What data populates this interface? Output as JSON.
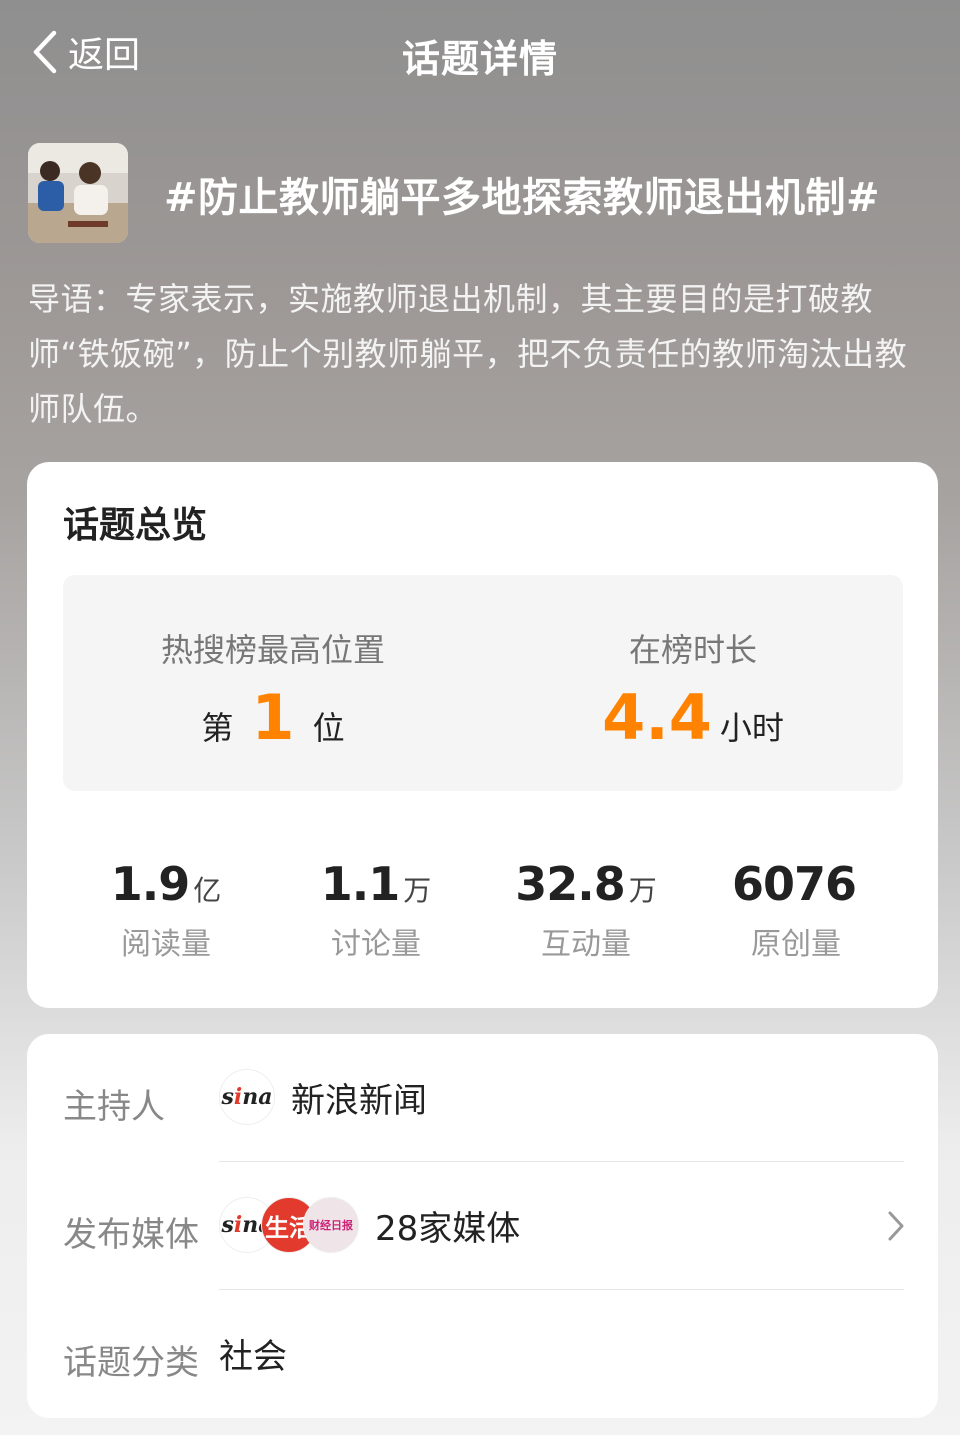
{
  "header": {
    "back_label": "返回",
    "title": "话题详情"
  },
  "topic": {
    "title": "#防止教师躺平多地探索教师退出机制#",
    "intro": "导语：专家表示，实施教师退出机制，其主要目的是打破教师“铁饭碗”，防止个别教师躺平，把不负责任的教师淘汰出教师队伍。"
  },
  "overview": {
    "heading": "话题总览",
    "rank": {
      "label": "热搜榜最高位置",
      "prefix": "第",
      "value": "1",
      "suffix": "位"
    },
    "duration": {
      "label": "在榜时长",
      "value": "4.4",
      "unit": "小时"
    },
    "stats": [
      {
        "value": "1.9",
        "unit": "亿",
        "label": "阅读量"
      },
      {
        "value": "1.1",
        "unit": "万",
        "label": "讨论量"
      },
      {
        "value": "32.8",
        "unit": "万",
        "label": "互动量"
      },
      {
        "value": "6076",
        "unit": "",
        "label": "原创量"
      }
    ]
  },
  "details": {
    "host": {
      "label": "主持人",
      "logo": "sina",
      "name": "新浪新闻"
    },
    "media": {
      "label": "发布媒体",
      "logos": [
        "sina",
        "生活",
        "财经日报"
      ],
      "value": "28家媒体"
    },
    "category": {
      "label": "话题分类",
      "value": "社会"
    }
  },
  "colors": {
    "accent": "#ff8200",
    "card": "#ffffff",
    "muted": "#888888"
  }
}
